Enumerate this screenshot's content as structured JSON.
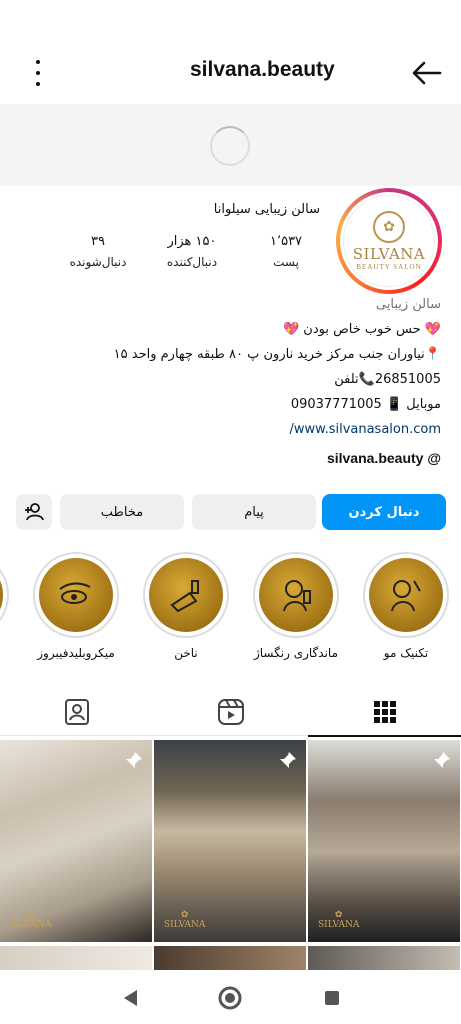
{
  "header": {
    "username": "silvana.beauty",
    "menu_icon": "more-vertical-icon",
    "back_icon": "arrow-left-icon"
  },
  "profile": {
    "avatar": {
      "brand": "SILVANA",
      "sub": "BEAUTY SALON"
    },
    "full_name": "سالن زیبایی سیلوانا",
    "stats": [
      {
        "value": "۱٬۵۳۷",
        "label": "پست"
      },
      {
        "value": "۱۵۰ هزار",
        "label": "دنبال‌کننده"
      },
      {
        "value": "۳۹",
        "label": "دنبال‌شونده"
      }
    ],
    "bio": {
      "category": "سالن زیبایی",
      "line1": "💖 حس خوب خاص بودن 💖",
      "line2": "📍نیاوران جنب مرکز خرید نارون پ ۸۰ طبقه چهارم واحد ۱۵",
      "line3": "26851005📞تلفن",
      "line4": "موبایل 📱 09037771005",
      "link": "www.silvanasalon.com/",
      "threads": "silvana.beauty"
    }
  },
  "actions": {
    "follow": "دنبال کردن",
    "message": "پیام",
    "contact": "مخاطب"
  },
  "highlights": [
    {
      "label": "تکنیک مو"
    },
    {
      "label": "ماندگاری رنگساژ"
    },
    {
      "label": "ناخن"
    },
    {
      "label": "میکروبلیدفیبروز"
    }
  ],
  "tabs": [
    "grid-icon",
    "reels-icon",
    "tagged-icon"
  ],
  "nav": [
    "back-triangle-icon",
    "home-circle-icon",
    "recents-square-icon"
  ],
  "colors": {
    "accent": "#0095f6",
    "gold": "#b58a2a"
  }
}
